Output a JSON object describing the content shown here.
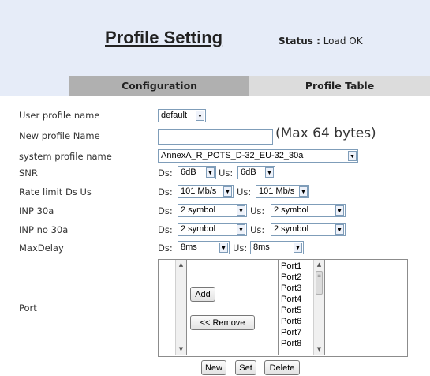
{
  "header": {
    "title": "Profile Setting",
    "status_label": "Status :",
    "status_value": "Load OK"
  },
  "tabs": [
    {
      "label": "Configuration",
      "active": true
    },
    {
      "label": "Profile Table",
      "active": false
    }
  ],
  "form": {
    "user_profile_name": {
      "label": "User profile name",
      "value": "default"
    },
    "new_profile_name": {
      "label": "New profile Name",
      "value": "",
      "note": "(Max 64 bytes)"
    },
    "system_profile_name": {
      "label": "system profile name",
      "value": "AnnexA_R_POTS_D-32_EU-32_30a"
    },
    "snr": {
      "label": "SNR",
      "ds_label": "Ds:",
      "ds_value": "6dB",
      "us_label": "Us:",
      "us_value": "6dB"
    },
    "rate_limit": {
      "label": "Rate limit Ds Us",
      "ds_label": "Ds:",
      "ds_value": "101 Mb/s",
      "us_label": "Us:",
      "us_value": "101 Mb/s"
    },
    "inp_30a": {
      "label": "INP 30a",
      "ds_label": "Ds:",
      "ds_value": "2 symbol",
      "us_label": "Us:",
      "us_value": "2 symbol"
    },
    "inp_no_30a": {
      "label": "INP no 30a",
      "ds_label": "Ds:",
      "ds_value": "2 symbol",
      "us_label": "Us:",
      "us_value": "2 symbol"
    },
    "max_delay": {
      "label": "MaxDelay",
      "ds_label": "Ds:",
      "ds_value": "8ms",
      "us_label": "Us:",
      "us_value": "8ms"
    },
    "port": {
      "label": "Port",
      "add_label": "Add",
      "remove_label": "<< Remove",
      "available_ports": [
        "Port1",
        "Port2",
        "Port3",
        "Port4",
        "Port5",
        "Port6",
        "Port7",
        "Port8"
      ]
    }
  },
  "actions": {
    "new_label": "New",
    "set_label": "Set",
    "delete_label": "Delete"
  },
  "colors": {
    "header_bg": "#e6ecf8",
    "active_tab": "#b0b0b0",
    "inactive_tab": "#dcdcdc"
  }
}
